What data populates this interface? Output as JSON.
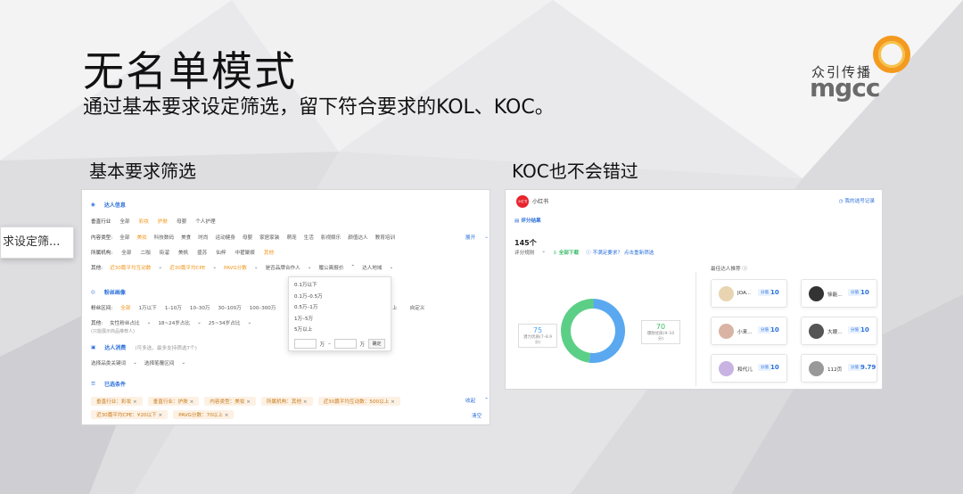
{
  "slide": {
    "title": "无名单模式",
    "subtitle": "通过基本要求设定筛选，留下符合要求的KOL、KOC。",
    "left_label": "基本要求筛选",
    "right_label": "KOC也不会错过",
    "tooltip": "求设定筛...",
    "logo_text": "众引传播",
    "logo_mark": "mgcc"
  },
  "filter": {
    "talent_info": "达人信息",
    "industry_label": "垂直行业",
    "industry_opts": [
      "全部",
      "彩妆",
      "护肤",
      "母婴",
      "个人护理"
    ],
    "content_label": "内容类型:",
    "content_opts": [
      "全部",
      "美妆",
      "科技数码",
      "美食",
      "时尚",
      "运动健身",
      "母婴",
      "家居家装",
      "萌宠",
      "生活",
      "影视娱乐",
      "颜值达人",
      "教育培训"
    ],
    "expand": "展开",
    "agency_label": "所属机构:",
    "agency_opts": [
      "全部",
      "二咖",
      "街溜",
      "美帆",
      "盛苏",
      "仙梓",
      "中翟聚娱",
      "其他"
    ],
    "other_label": "其他:",
    "other_opts": [
      "近30篇平均互动数",
      "近30篇平均CPE",
      "PAVG分数",
      "是否品牌合作人",
      "履公离报价",
      "达人地域"
    ],
    "fans_head": "粉丝画像",
    "fans_label": "粉丝区间:",
    "fans_opts": [
      "全部",
      "1万以下",
      "1–10万",
      "10–30万",
      "30–100万",
      "100–300万"
    ],
    "fans_extra": [
      "上",
      "自定义"
    ],
    "fans_other_label": "其他:",
    "fans_other_opts": [
      "女性粉丝占比",
      "18~24岁占比",
      "25~34岁占比"
    ],
    "fans_note": "(只能展示商品推荐人)",
    "consume_head": "达人消费",
    "consume_note": "(可多选，最多支持筛选7个)",
    "consume_opts": [
      "选择品类关键词",
      "选择笔覆区间"
    ],
    "selected_head": "已选条件",
    "chips": [
      "垂直行业：彩妆",
      "垂直行业：护肤",
      "内容类型：美妆",
      "所属机构：其他",
      "近30篇平均互动数：500以上",
      "近30篇平均CPE：¥20以下",
      "PAVG分数：70以上"
    ],
    "collapse": "收起",
    "clear": "清空"
  },
  "dropdown": {
    "options": [
      "0.1万以下",
      "0.1万–0.5万",
      "0.5万–1万",
      "1万–5万",
      "5万以上"
    ],
    "unit": "万",
    "confirm": "确定"
  },
  "result": {
    "platform": "小红书",
    "platform_badge": "小红书",
    "my_record": "我的选号记录",
    "title": "评分结果",
    "count": "145个",
    "eval_label": "评分规则",
    "download": "全部下载",
    "unsatisfied": "不满足要求？ 点击重新筛选",
    "left_value": "75",
    "left_caption": "潜力优质(7–8.9分)",
    "right_value": "70",
    "right_caption": "爆款优质(9–10分)",
    "recommend": "最佳达人推荐",
    "score_label": "分值",
    "cards": [
      {
        "name": "JOA...",
        "score": "10"
      },
      {
        "name": "徐能...",
        "score": "10"
      },
      {
        "name": "小来...",
        "score": "10"
      },
      {
        "name": "大眼...",
        "score": "10"
      },
      {
        "name": "和代儿",
        "score": "10"
      },
      {
        "name": "112页",
        "score": "9.79"
      }
    ],
    "colors": {
      "blue": "#5aa9f0",
      "green": "#5ccf86"
    }
  },
  "chart_data": {
    "type": "pie",
    "categories": [
      "潜力优质(7–8.9分)",
      "爆款优质(9–10分)"
    ],
    "values": [
      75,
      70
    ]
  }
}
